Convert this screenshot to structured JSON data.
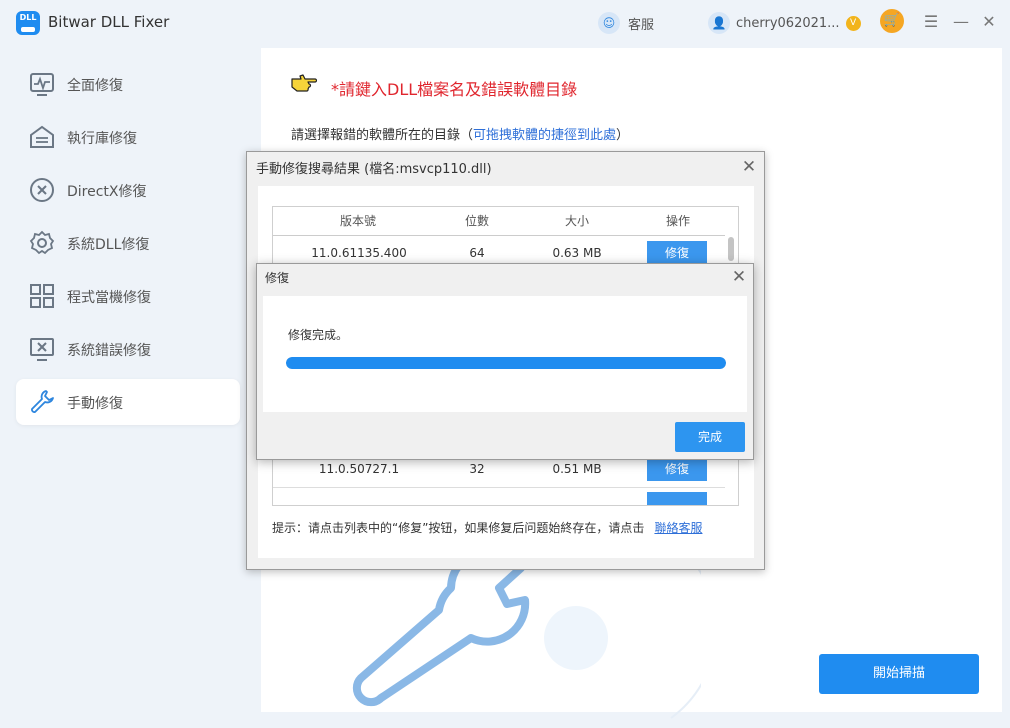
{
  "titlebar": {
    "app_name": "Bitwar DLL Fixer",
    "logo_text": "DLL",
    "support_label": "客服",
    "username": "cherry062021...",
    "window_controls": [
      "menu-icon",
      "minimize-icon",
      "close-icon"
    ]
  },
  "sidebar": {
    "items": [
      {
        "label": "全面修復",
        "icon": "pulse-monitor-icon"
      },
      {
        "label": "執行庫修復",
        "icon": "library-icon"
      },
      {
        "label": "DirectX修復",
        "icon": "x-circle-icon"
      },
      {
        "label": "系統DLL修復",
        "icon": "gear-icon"
      },
      {
        "label": "程式當機修復",
        "icon": "grid-icon"
      },
      {
        "label": "系統錯誤修復",
        "icon": "monitor-x-icon"
      },
      {
        "label": "手動修復",
        "icon": "wrench-icon",
        "active": true
      }
    ]
  },
  "main": {
    "heading": "*請鍵入DLL檔案名及錯誤軟體目錄",
    "dir_label_prefix": "請選擇報錯的軟體所在的目錄（",
    "dir_label_link": "可拖拽軟體的捷徑到此處",
    "dir_label_suffix": "）",
    "scan_button": "開始掃描"
  },
  "search_dialog": {
    "title": "手動修復搜尋結果 (檔名:msvcp110.dll)",
    "columns": [
      "版本號",
      "位數",
      "大小",
      "操作"
    ],
    "rows": [
      {
        "version": "11.0.61135.400",
        "bits": "64",
        "size": "0.63 MB",
        "action": "修復"
      },
      {
        "version": "11.0.50727.1",
        "bits": "32",
        "size": "0.51 MB",
        "action": "修復"
      }
    ],
    "hint": "提示：请点击列表中的“修复”按钮，如果修复后问题始終存在，请点击",
    "hint_link": "聯絡客服"
  },
  "repair_dialog": {
    "title": "修復",
    "status": "修復完成。",
    "progress": 1.0,
    "done_button": "完成"
  },
  "colors": {
    "accent": "#1f8cf0",
    "heading_red": "#e0262e",
    "link_blue": "#2e6fd8",
    "sidebar_bg": "#eef3f9"
  }
}
